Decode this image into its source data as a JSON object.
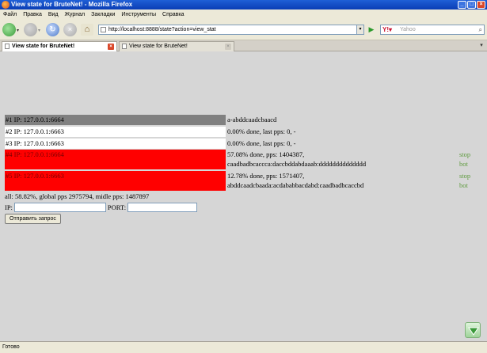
{
  "window": {
    "title": "View state for BruteNet! - Mozilla Firefox"
  },
  "menu": {
    "items": [
      "Файл",
      "Правка",
      "Вид",
      "Журнал",
      "Закладки",
      "Инструменты",
      "Справка"
    ]
  },
  "toolbar": {
    "url": "http://localhost:8888/state?action=view_stat",
    "search_placeholder": "Yahoo"
  },
  "tabs": [
    {
      "label": "View state for BruteNet!",
      "active": true
    },
    {
      "label": "View state for BruteNet!",
      "active": false
    }
  ],
  "jobs": [
    {
      "label": "#1 IP: 127.0.0.1:6664",
      "info_line1": "a-abddcaadcbaacd",
      "info_line2": "",
      "stop": "",
      "bot": "",
      "status_color": "#808080"
    },
    {
      "label": "#2 IP: 127.0.0.1:6663",
      "info_line1": "0.00% done, last pps: 0, -",
      "info_line2": "",
      "stop": "",
      "bot": "",
      "status_color": "#ffffff"
    },
    {
      "label": "#3 IP: 127.0.0.1:6663",
      "info_line1": "0.00% done, last pps: 0, -",
      "info_line2": "",
      "stop": "",
      "bot": "",
      "status_color": "#ffffff"
    },
    {
      "label": "#4 IP: 127.0.0.1:6664",
      "info_line1": "57.08% done, pps: 1404387,",
      "info_line2": "caadbadbcaccca:daccbddabdaaab:dddddddddddddd",
      "stop": "stop",
      "bot": "bot",
      "status_color": "#ff0000"
    },
    {
      "label": "#5 IP: 127.0.0.1:6663",
      "info_line1": "12.78% done, pps: 1571407,",
      "info_line2": "abddcaadcbaada:acdababbacdabd:caadbadbcaccbd",
      "stop": "stop",
      "bot": "bot",
      "status_color": "#ff0000"
    }
  ],
  "summary": "all: 58.82%, global pps 2975794, midle pps: 1487897",
  "form": {
    "ip_label": "IP:",
    "port_label": "PORT:",
    "submit_label": "Отправить запрос"
  },
  "status_bar": "Готово",
  "colors": {
    "accent_action": "#5f9b3f",
    "red_status": "#ff0000",
    "gray_status": "#808080"
  }
}
